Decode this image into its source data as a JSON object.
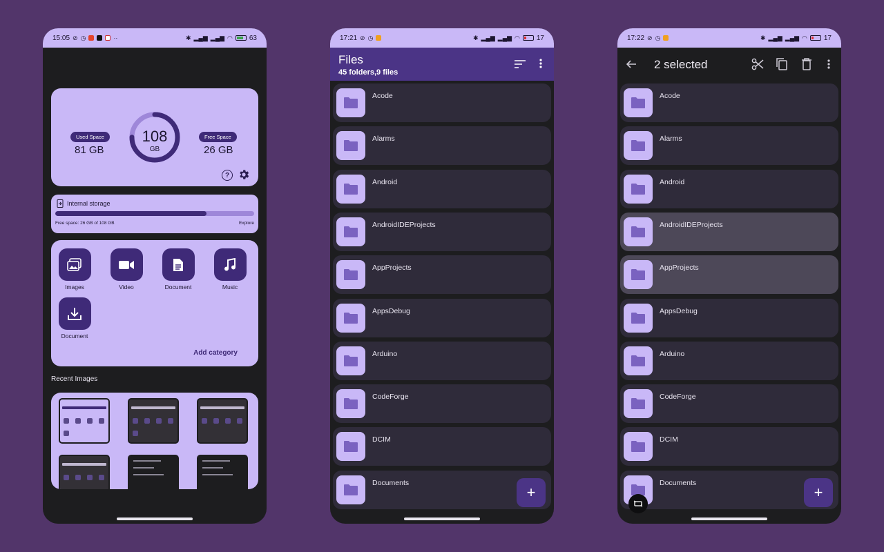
{
  "phone1": {
    "status": {
      "time": "15:05",
      "battery": "63"
    },
    "storage": {
      "used_label": "Used Space",
      "used_value": "81 GB",
      "total_value": "108",
      "total_unit": "GB",
      "free_label": "Free Space",
      "free_value": "26 GB",
      "used_fraction": 0.75
    },
    "internal": {
      "title": "Internal storage",
      "free_text": "Free space: 26 GB of 108 GB",
      "explore": "Explore",
      "used_fraction": 0.76
    },
    "categories": [
      {
        "label": "Images",
        "icon": "image-icon"
      },
      {
        "label": "Video",
        "icon": "video-icon"
      },
      {
        "label": "Document",
        "icon": "document-icon"
      },
      {
        "label": "Music",
        "icon": "music-icon"
      },
      {
        "label": "Document",
        "icon": "download-icon"
      }
    ],
    "add_category": "Add category",
    "recent_label": "Recent Images"
  },
  "phone2": {
    "status": {
      "time": "17:21",
      "battery": "17"
    },
    "title": "Files",
    "subtitle": "45 folders,9 files",
    "folders": [
      "Acode",
      "Alarms",
      "Android",
      "AndroidIDEProjects",
      "AppProjects",
      "AppsDebug",
      "Arduino",
      "CodeForge",
      "DCIM",
      "Documents"
    ],
    "fab": "+"
  },
  "phone3": {
    "status": {
      "time": "17:22",
      "battery": "17"
    },
    "title": "2 selected",
    "folders": [
      "Acode",
      "Alarms",
      "Android",
      "AndroidIDEProjects",
      "AppProjects",
      "AppsDebug",
      "Arduino",
      "CodeForge",
      "DCIM",
      "Documents"
    ],
    "selected": [
      "AndroidIDEProjects",
      "AppProjects"
    ],
    "fab": "+"
  },
  "colors": {
    "accent": "#4b3486",
    "surface": "#c9b8f7",
    "background": "#52356a"
  }
}
